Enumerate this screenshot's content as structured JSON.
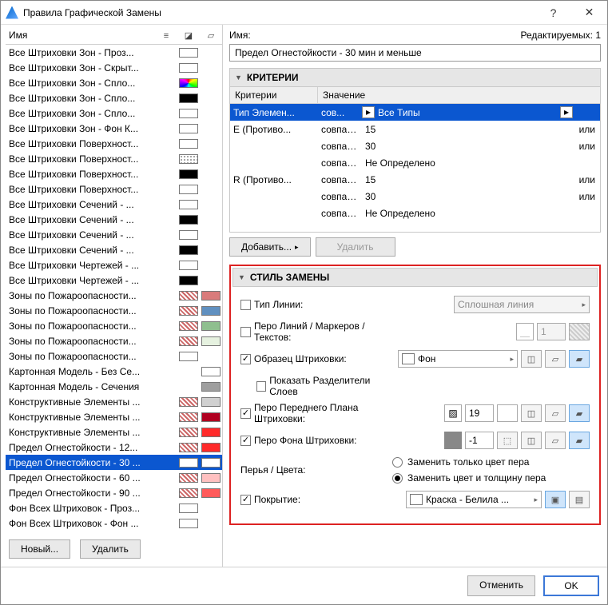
{
  "window": {
    "title": "Правила Графической Замены",
    "help": "?",
    "close": "✕"
  },
  "left": {
    "name_label": "Имя",
    "new_btn": "Новый...",
    "delete_btn": "Удалить",
    "rules": [
      {
        "name": "Все Штриховки Зон - Проз...",
        "sw1": "#ffffff",
        "sw2": null
      },
      {
        "name": "Все Штриховки Зон - Скрыт...",
        "sw1": "#ffffff",
        "sw2": null
      },
      {
        "name": "Все Штриховки Зон - Спло...",
        "sw1": "multi",
        "sw2": null
      },
      {
        "name": "Все Штриховки Зон - Спло...",
        "sw1": "#000000",
        "sw2": null
      },
      {
        "name": "Все Штриховки Зон - Спло...",
        "sw1": "#ffffff",
        "sw2": null
      },
      {
        "name": "Все Штриховки Зон - Фон К...",
        "sw1": "#ffffff",
        "sw2": null
      },
      {
        "name": "Все Штриховки Поверхност...",
        "sw1": "#ffffff",
        "sw2": null
      },
      {
        "name": "Все Штриховки Поверхност...",
        "sw1": "dots",
        "sw2": null
      },
      {
        "name": "Все Штриховки Поверхност...",
        "sw1": "#000000",
        "sw2": null
      },
      {
        "name": "Все Штриховки Поверхност...",
        "sw1": "#ffffff",
        "sw2": null
      },
      {
        "name": "Все Штриховки Сечений - ...",
        "sw1": "#ffffff",
        "sw2": null
      },
      {
        "name": "Все Штриховки Сечений - ...",
        "sw1": "#000000",
        "sw2": null
      },
      {
        "name": "Все Штриховки Сечений - ...",
        "sw1": "#ffffff",
        "sw2": null
      },
      {
        "name": "Все Штриховки Сечений - ...",
        "sw1": "#000000",
        "sw2": null
      },
      {
        "name": "Все Штриховки Чертежей - ...",
        "sw1": "#ffffff",
        "sw2": null
      },
      {
        "name": "Все Штриховки Чертежей - ...",
        "sw1": "#000000",
        "sw2": null
      },
      {
        "name": "Зоны по Пожароопасности...",
        "sw1": "hatch",
        "sw2": "#d97b7b"
      },
      {
        "name": "Зоны по Пожароопасности...",
        "sw1": "hatch",
        "sw2": "#6090c0"
      },
      {
        "name": "Зоны по Пожароопасности...",
        "sw1": "hatch",
        "sw2": "#8fbf8f"
      },
      {
        "name": "Зоны по Пожароопасности...",
        "sw1": "hatch",
        "sw2": "#e6f2e0"
      },
      {
        "name": "Зоны по Пожароопасности...",
        "sw1": "#ffffff",
        "sw2": null
      },
      {
        "name": "Картонная Модель - Без Се...",
        "sw1": null,
        "sw2": "#ffffff"
      },
      {
        "name": "Картонная Модель - Сечения",
        "sw1": null,
        "sw2": "#9e9e9e"
      },
      {
        "name": "Конструктивные Элементы ...",
        "sw1": "hatch",
        "sw2": "#d0d0d0"
      },
      {
        "name": "Конструктивные Элементы ...",
        "sw1": "hatch",
        "sw2": "#b00020"
      },
      {
        "name": "Конструктивные Элементы ...",
        "sw1": "hatch",
        "sw2": "#ff2a2a"
      },
      {
        "name": "Предел Огнестойкости - 12...",
        "sw1": "hatch",
        "sw2": "#ff2a2a"
      },
      {
        "name": "Предел Огнестойкости - 30 ...",
        "sw1": "#ffffff",
        "sw2": "#ffffff",
        "sel": true
      },
      {
        "name": "Предел Огнестойкости - 60 ...",
        "sw1": "hatch",
        "sw2": "#ffc0c0"
      },
      {
        "name": "Предел Огнестойкости - 90 ...",
        "sw1": "hatch",
        "sw2": "#ff5a5a"
      },
      {
        "name": "Фон Всех Штриховок - Проз...",
        "sw1": "#ffffff",
        "sw2": null
      },
      {
        "name": "Фон Всех Штриховок - Фон ...",
        "sw1": "#ffffff",
        "sw2": null
      }
    ]
  },
  "right": {
    "name_label": "Имя:",
    "editable_label": "Редактируемых: 1",
    "name_value": "Предел Огнестойкости - 30 мин и меньше",
    "criteria": {
      "title": "КРИТЕРИИ",
      "col1": "Критерии",
      "col2": "Значение",
      "add_btn": "Добавить...",
      "del_btn": "Удалить",
      "rows": [
        {
          "c": "Тип Элемен...",
          "m": "сов...",
          "v": "Все Типы",
          "sel": true,
          "arrow": true,
          "end": ""
        },
        {
          "c": "E (Противо...",
          "m": "совпад...",
          "v": "15",
          "end": "или"
        },
        {
          "c": "",
          "m": "совпад...",
          "v": "30",
          "end": "или"
        },
        {
          "c": "",
          "m": "совпад...",
          "v": "Не Определено",
          "end": ""
        },
        {
          "c": "R (Противо...",
          "m": "совпад...",
          "v": "15",
          "end": "или"
        },
        {
          "c": "",
          "m": "совпад...",
          "v": "30",
          "end": "или"
        },
        {
          "c": "",
          "m": "совпад...",
          "v": "Не Определено",
          "end": ""
        }
      ]
    },
    "style": {
      "title": "СТИЛЬ ЗАМЕНЫ",
      "line_type": "Тип Линии:",
      "line_type_val": "Сплошная линия",
      "pen_lines": "Перо Линий / Маркеров / Текстов:",
      "pen_lines_val": "1",
      "fill_pattern": "Образец Штриховки:",
      "fill_pattern_val": "Фон",
      "show_sep": "Показать Разделители Слоев",
      "fg_pen": "Перо Переднего Плана Штриховки:",
      "fg_pen_val": "19",
      "bg_pen": "Перо Фона Штриховки:",
      "bg_pen_val": "-1",
      "pens_colors": "Перья / Цвета:",
      "radio1": "Заменить только цвет пера",
      "radio2": "Заменить цвет и толщину пера",
      "surface": "Покрытие:",
      "surface_val": "Краска - Белила ..."
    }
  },
  "footer": {
    "cancel": "Отменить",
    "ok": "OK"
  }
}
